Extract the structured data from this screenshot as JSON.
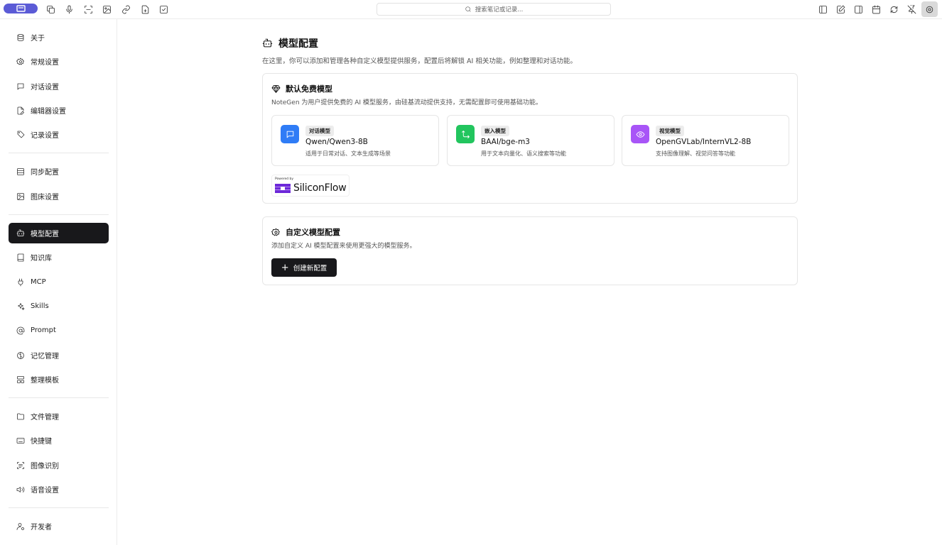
{
  "toolbar": {
    "search_placeholder": "搜索笔记或记录...",
    "left_icons": [
      "app-logo",
      "copy-icon",
      "mic-icon",
      "scan-icon",
      "image-plus-icon",
      "link-icon",
      "file-plus-icon",
      "checkbox-icon"
    ],
    "right_icons": [
      "panel-left-icon",
      "edit-icon",
      "panel-right-icon",
      "calendar-icon",
      "sync-icon",
      "pin-off-icon",
      "settings-icon"
    ]
  },
  "sidebar": {
    "items": [
      {
        "label": "关于",
        "icon": "about-icon"
      },
      {
        "label": "常规设置",
        "icon": "gear-icon"
      },
      {
        "label": "对话设置",
        "icon": "chat-icon"
      },
      {
        "label": "编辑器设置",
        "icon": "file-edit-icon"
      },
      {
        "label": "记录设置",
        "icon": "tag-icon"
      },
      {
        "label": "同步配置",
        "icon": "database-icon"
      },
      {
        "label": "图床设置",
        "icon": "image-icon"
      },
      {
        "label": "模型配置",
        "icon": "bot-icon"
      },
      {
        "label": "知识库",
        "icon": "book-icon"
      },
      {
        "label": "MCP",
        "icon": "plug-icon"
      },
      {
        "label": "Skills",
        "icon": "sparkles-icon"
      },
      {
        "label": "Prompt",
        "icon": "at-icon"
      },
      {
        "label": "记忆管理",
        "icon": "brain-icon"
      },
      {
        "label": "整理模板",
        "icon": "layout-icon"
      },
      {
        "label": "文件管理",
        "icon": "folder-icon"
      },
      {
        "label": "快捷键",
        "icon": "keyboard-icon"
      },
      {
        "label": "图像识别",
        "icon": "scan-text-icon"
      },
      {
        "label": "语音设置",
        "icon": "speaker-icon"
      },
      {
        "label": "开发者",
        "icon": "user-cog-icon"
      }
    ],
    "active": "模型配置"
  },
  "main": {
    "title": "模型配置",
    "description": "在这里，你可以添加和管理各种自定义模型提供服务，配置后将解锁 AI 相关功能，例如整理和对话功能。",
    "default_card": {
      "title": "默认免费模型",
      "description": "NoteGen 为用户提供免费的 AI 模型服务，由硅基流动提供支持，无需配置即可使用基础功能。",
      "models": [
        {
          "tag": "对话模型",
          "name": "Qwen/Qwen3-8B",
          "desc": "适用于日常对话、文本生成等场景",
          "icon": "chat-icon",
          "color": "#2f7cf6"
        },
        {
          "tag": "嵌入模型",
          "name": "BAAI/bge-m3",
          "desc": "用于文本向量化、语义搜索等功能",
          "icon": "arrows-icon",
          "color": "#22c55e"
        },
        {
          "tag": "视觉模型",
          "name": "OpenGVLab/InternVL2-8B",
          "desc": "支持图像理解、视觉问答等功能",
          "icon": "eye-icon",
          "color": "#a855f7"
        }
      ],
      "powered_by": "Powered by",
      "provider": "SiliconFlow"
    },
    "custom_card": {
      "title": "自定义模型配置",
      "description": "添加自定义 AI 模型配置来使用更强大的模型服务。",
      "button": "创建新配置"
    }
  }
}
